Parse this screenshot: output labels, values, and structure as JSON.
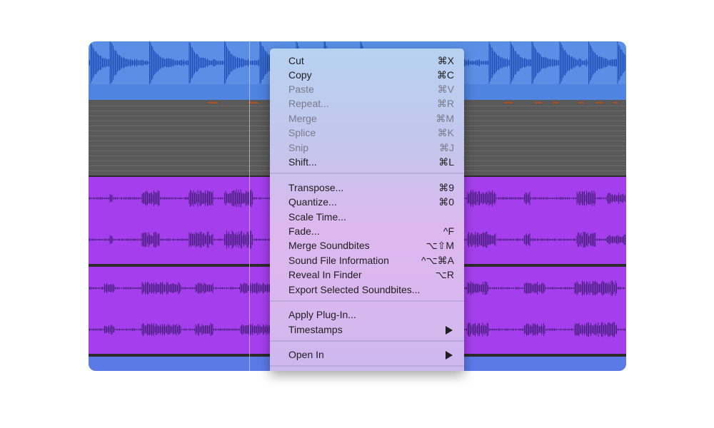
{
  "menu": {
    "items": [
      {
        "label": "Cut",
        "shortcut": "⌘X",
        "enabled": true
      },
      {
        "label": "Copy",
        "shortcut": "⌘C",
        "enabled": true
      },
      {
        "label": "Paste",
        "shortcut": "⌘V",
        "enabled": false
      },
      {
        "label": "Repeat...",
        "shortcut": "⌘R",
        "enabled": false
      },
      {
        "label": "Merge",
        "shortcut": "⌘M",
        "enabled": false
      },
      {
        "label": "Splice",
        "shortcut": "⌘K",
        "enabled": false
      },
      {
        "label": "Snip",
        "shortcut": "⌘J",
        "enabled": false
      },
      {
        "label": "Shift...",
        "shortcut": "⌘L",
        "enabled": true
      },
      {
        "label": "Transpose...",
        "shortcut": "⌘9",
        "enabled": true
      },
      {
        "label": "Quantize...",
        "shortcut": "⌘0",
        "enabled": true
      },
      {
        "label": "Scale Time...",
        "shortcut": "",
        "enabled": true
      },
      {
        "label": "Fade...",
        "shortcut": "^F",
        "enabled": true
      },
      {
        "label": "Merge Soundbites",
        "shortcut": "⌥⇧M",
        "enabled": true
      },
      {
        "label": "Sound File Information",
        "shortcut": "^⌥⌘A",
        "enabled": true
      },
      {
        "label": "Reveal In Finder",
        "shortcut": "⌥R",
        "enabled": true
      },
      {
        "label": "Export Selected Soundbites...",
        "shortcut": "",
        "enabled": true
      },
      {
        "label": "Apply Plug-In...",
        "shortcut": "",
        "enabled": true
      },
      {
        "label": "Timestamps",
        "shortcut": "",
        "enabled": true,
        "submenu": true
      },
      {
        "label": "Open In",
        "shortcut": "",
        "enabled": true,
        "submenu": true
      }
    ]
  },
  "colors": {
    "audio_track_blue": "#5b8fe6",
    "midi_track_gray": "#595959",
    "audio_track_purple": "#a53fee",
    "waveform_blue": "#1f4fb8",
    "waveform_purple": "#4a1f80",
    "midi_note": "#b5501e"
  },
  "icons": {
    "submenu": "triangle-right-icon"
  }
}
